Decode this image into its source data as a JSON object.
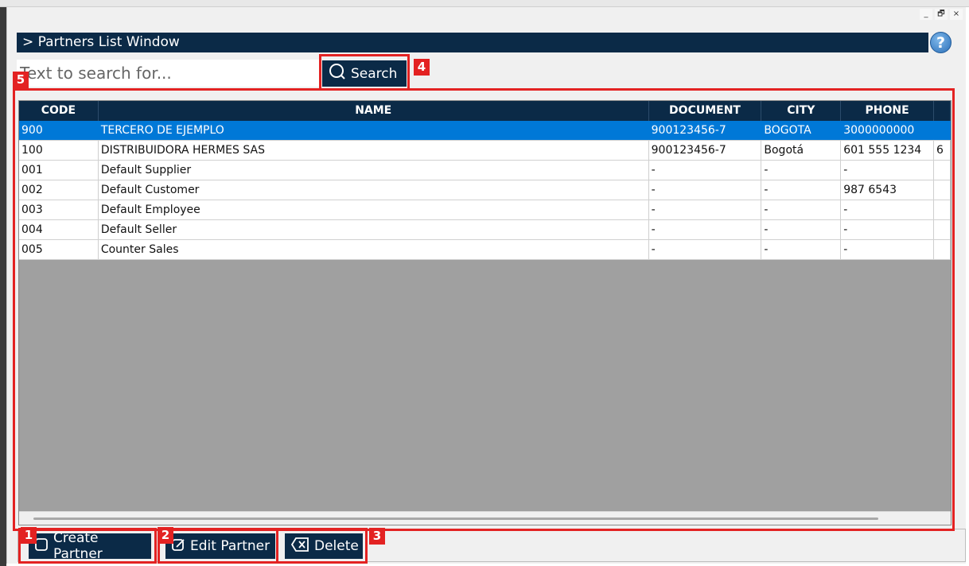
{
  "window": {
    "title": "> Partners List Window",
    "controls": {
      "minimize": "_",
      "restore": "🗗",
      "close": "×"
    }
  },
  "help": {
    "label": "?"
  },
  "search": {
    "placeholder": "Text to search for...",
    "value": "",
    "button_label": "Search"
  },
  "table": {
    "columns": [
      "CODE",
      "NAME",
      "DOCUMENT",
      "CITY",
      "PHONE"
    ],
    "rows": [
      {
        "code": "900",
        "name": "TERCERO DE EJEMPLO",
        "document": "900123456-7",
        "city": "BOGOTA",
        "phone": "3000000000",
        "extra": "",
        "selected": true
      },
      {
        "code": "100",
        "name": "DISTRIBUIDORA HERMES SAS",
        "document": "900123456-7",
        "city": "Bogotá",
        "phone": "601 555 1234",
        "extra": "6"
      },
      {
        "code": "001",
        "name": "Default Supplier",
        "document": "-",
        "city": "-",
        "phone": "-",
        "extra": ""
      },
      {
        "code": "002",
        "name": "Default Customer",
        "document": "-",
        "city": "-",
        "phone": "987 6543",
        "extra": ""
      },
      {
        "code": "003",
        "name": "Default Employee",
        "document": "-",
        "city": "-",
        "phone": "-",
        "extra": ""
      },
      {
        "code": "004",
        "name": "Default Seller",
        "document": "-",
        "city": "-",
        "phone": "-",
        "extra": ""
      },
      {
        "code": "005",
        "name": "Counter Sales",
        "document": "-",
        "city": "-",
        "phone": "-",
        "extra": ""
      }
    ]
  },
  "actions": {
    "create_label": "Create Partner",
    "edit_label": "Edit Partner",
    "delete_label": "Delete"
  },
  "badges": [
    "1",
    "2",
    "3",
    "4",
    "5"
  ],
  "colors": {
    "navy": "#0b2a47",
    "highlight": "#e32222",
    "selection": "#0078d7",
    "empty_area": "#a0a0a0"
  }
}
